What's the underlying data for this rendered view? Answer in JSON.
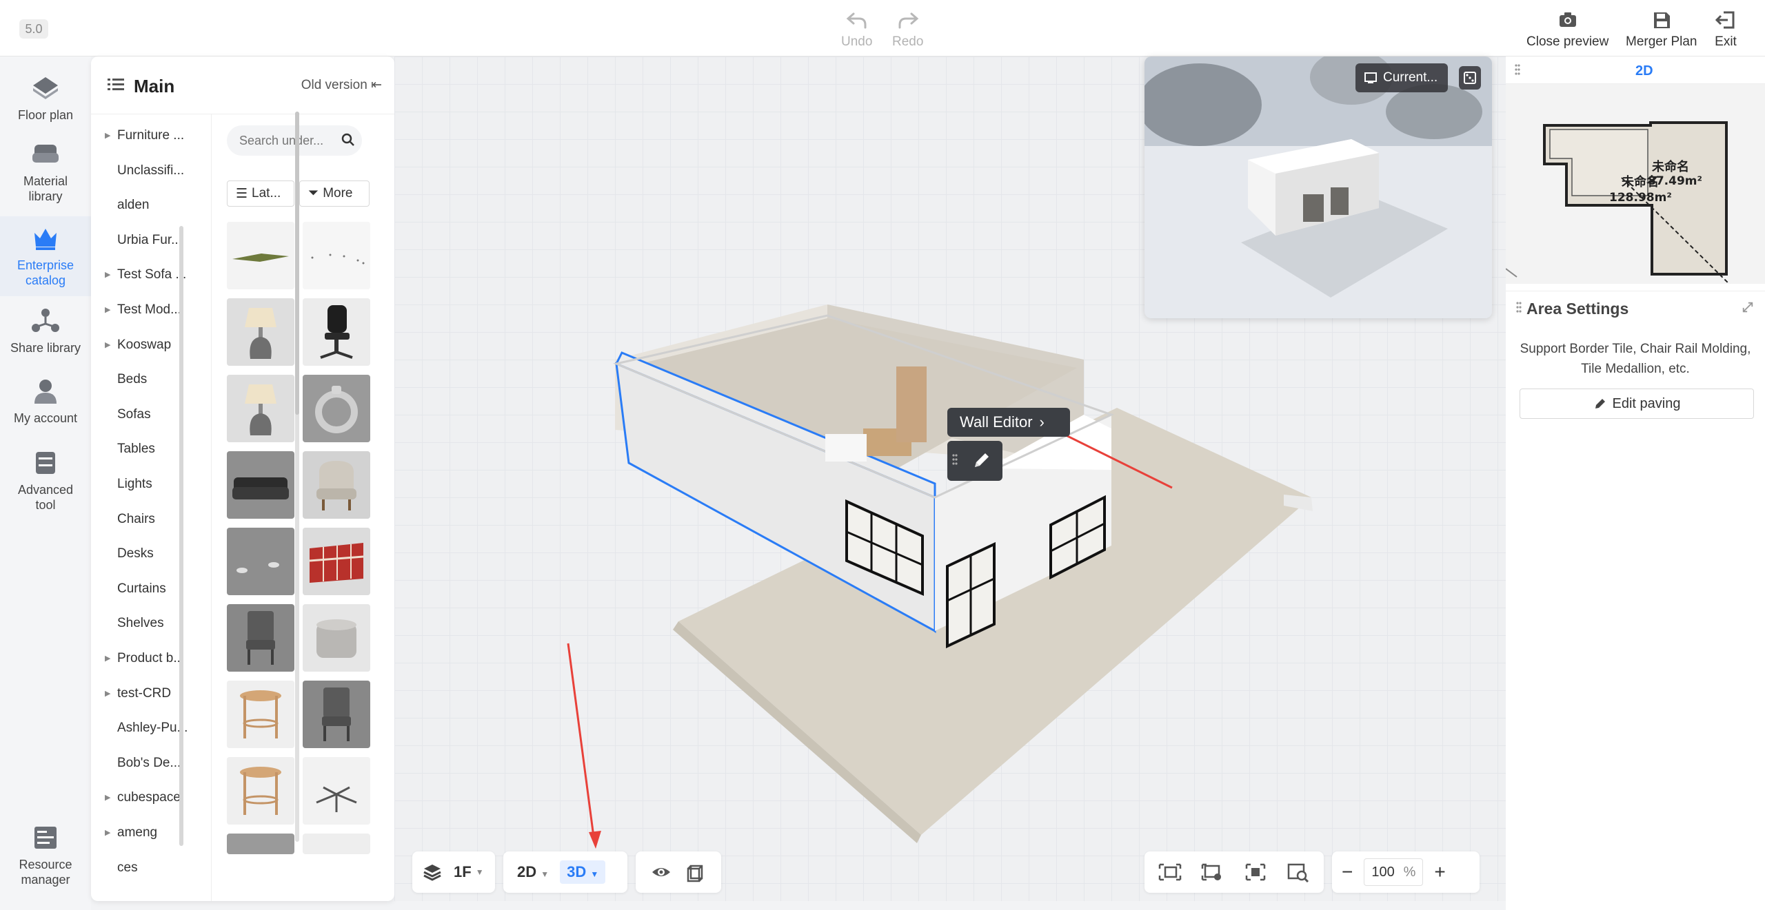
{
  "app": {
    "version": "5.0"
  },
  "toolbar": {
    "undo": "Undo",
    "redo": "Redo",
    "close_preview": "Close preview",
    "merger_plan": "Merger Plan",
    "exit": "Exit"
  },
  "rail": {
    "items": [
      {
        "label": "Floor plan"
      },
      {
        "label": "Material\nlibrary"
      },
      {
        "label": "Enterprise\ncatalog"
      },
      {
        "label": "Share library"
      },
      {
        "label": "My account"
      },
      {
        "label": "Advanced\ntool"
      },
      {
        "label": "Resource\nmanager"
      }
    ],
    "active_index": 2
  },
  "catalog": {
    "title": "Main",
    "old_version": "Old version",
    "search_placeholder": "Search under...",
    "filter_latest": "Lat...",
    "filter_more": "More",
    "categories": [
      {
        "label": "Furniture ...",
        "has_children": true
      },
      {
        "label": "Unclassifi...",
        "has_children": false
      },
      {
        "label": "alden",
        "has_children": false
      },
      {
        "label": "Urbia Fur...",
        "has_children": false
      },
      {
        "label": "Test Sofa ...",
        "has_children": true
      },
      {
        "label": "Test Mod...",
        "has_children": true
      },
      {
        "label": "Kooswap",
        "has_children": true
      },
      {
        "label": "Beds",
        "has_children": false
      },
      {
        "label": "Sofas",
        "has_children": false
      },
      {
        "label": "Tables",
        "has_children": false
      },
      {
        "label": "Lights",
        "has_children": false
      },
      {
        "label": "Chairs",
        "has_children": false
      },
      {
        "label": "Desks",
        "has_children": false
      },
      {
        "label": "Curtains",
        "has_children": false
      },
      {
        "label": "Shelves",
        "has_children": false
      },
      {
        "label": "Product b...",
        "has_children": true
      },
      {
        "label": "test-CRD",
        "has_children": true
      },
      {
        "label": "Ashley-Pu...",
        "has_children": false
      },
      {
        "label": "Bob's De...",
        "has_children": false
      },
      {
        "label": "cubespace",
        "has_children": true
      },
      {
        "label": "ameng",
        "has_children": true
      },
      {
        "label": "ces",
        "has_children": false
      }
    ],
    "products": [
      {
        "icon": "rug-icon"
      },
      {
        "icon": "dots-icon"
      },
      {
        "icon": "table-lamp-icon"
      },
      {
        "icon": "office-chair-icon"
      },
      {
        "icon": "table-lamp-icon"
      },
      {
        "icon": "ring-icon"
      },
      {
        "icon": "sofa-icon"
      },
      {
        "icon": "armchair-icon"
      },
      {
        "icon": "small-objects-icon"
      },
      {
        "icon": "shelf-unit-icon"
      },
      {
        "icon": "dining-chair-icon"
      },
      {
        "icon": "ottoman-icon"
      },
      {
        "icon": "side-table-icon"
      },
      {
        "icon": "dining-chair-icon"
      },
      {
        "icon": "side-table-icon"
      },
      {
        "icon": "chair-base-icon"
      }
    ]
  },
  "viewport": {
    "wall_editor": "Wall Editor",
    "preview_current": "Current...",
    "floor": "1F",
    "view_2d": "2D",
    "view_3d": "3D",
    "zoom": "100",
    "zoom_unit": "%"
  },
  "right_panel": {
    "minimap_tab": "2D",
    "minimap_labels": [
      "未命名",
      "87.49m²",
      "未命名",
      "128.98m²"
    ],
    "area_title": "Area Settings",
    "area_desc": "Support Border Tile, Chair Rail Molding, Tile Medallion, etc.",
    "edit_paving": "Edit paving"
  },
  "colors": {
    "accent": "#2a7cf6",
    "annotation_arrow": "#e8413a",
    "tooltip_bg": "#3c3f44"
  }
}
